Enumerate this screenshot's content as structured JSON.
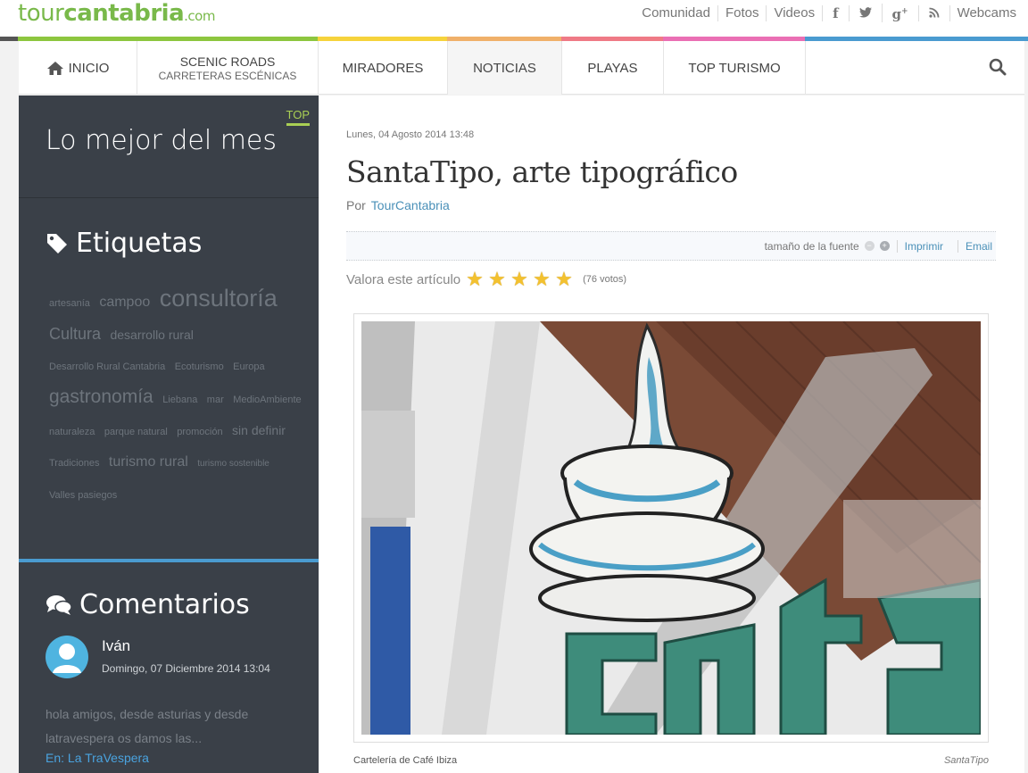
{
  "logo": {
    "part1": "tour",
    "part2": "cantabria",
    "part3": ".com"
  },
  "top_links": [
    "Comunidad",
    "Fotos",
    "Videos"
  ],
  "social_icons": [
    "facebook-icon",
    "twitter-icon",
    "google-plus-icon",
    "rss-icon"
  ],
  "webcams_label": "Webcams",
  "strip_colors": [
    "#8dc63f",
    "#f6d33c",
    "#f0b06a",
    "#ef7a86",
    "#ea6fb4",
    "#4a9bd0"
  ],
  "nav": {
    "home_label": "INICIO",
    "scenic_label": "SCENIC ROADS",
    "scenic_sub": "CARRETERAS ESCÉNICAS",
    "miradores_label": "MIRADORES",
    "noticias_label": "NOTICIAS",
    "playas_label": "PLAYAS",
    "top_turismo_label": "TOP TURISMO"
  },
  "sidebar": {
    "best_title": "Lo mejor del mes",
    "top_badge": "TOP",
    "tags_title": "Etiquetas",
    "tags": [
      {
        "label": "artesanía",
        "size": 11
      },
      {
        "label": "campoo",
        "size": 16
      },
      {
        "label": "consultoría",
        "size": 27
      },
      {
        "label": "Cultura",
        "size": 18
      },
      {
        "label": "desarrollo rural",
        "size": 14
      },
      {
        "label": "Desarrollo Rural Cantabria",
        "size": 11
      },
      {
        "label": "Ecoturismo",
        "size": 11
      },
      {
        "label": "Europa",
        "size": 11
      },
      {
        "label": "gastronomía",
        "size": 21
      },
      {
        "label": "Liebana",
        "size": 11
      },
      {
        "label": "mar",
        "size": 11
      },
      {
        "label": "MedioAmbiente",
        "size": 11
      },
      {
        "label": "naturaleza",
        "size": 11
      },
      {
        "label": "parque natural",
        "size": 11
      },
      {
        "label": "promoción",
        "size": 11
      },
      {
        "label": "sin definir",
        "size": 14
      },
      {
        "label": "Tradiciones",
        "size": 11
      },
      {
        "label": "turismo rural",
        "size": 16
      },
      {
        "label": "turismo sostenible",
        "size": 10
      },
      {
        "label": "Valles pasiegos",
        "size": 11
      }
    ],
    "comments_title": "Comentarios",
    "comment": {
      "author": "Iván",
      "date": "Domingo, 07 Diciembre 2014 13:04",
      "text": "hola amigos, desde asturias y desde latravespera os damos las...",
      "link": "En: La TraVespera"
    }
  },
  "article": {
    "date": "Lunes, 04 Agosto 2014 13:48",
    "title": "SantaTipo, arte tipográfico",
    "by_prefix": "Por",
    "author": "TourCantabria",
    "font_size_label": "tamaño de la fuente",
    "print_label": "Imprimir",
    "email_label": "Email",
    "rate_label": "Valora este artículo",
    "stars": 5,
    "votes": "(76 votos)",
    "caption": "Cartelería de Café Ibiza",
    "credit": "SantaTipo"
  }
}
